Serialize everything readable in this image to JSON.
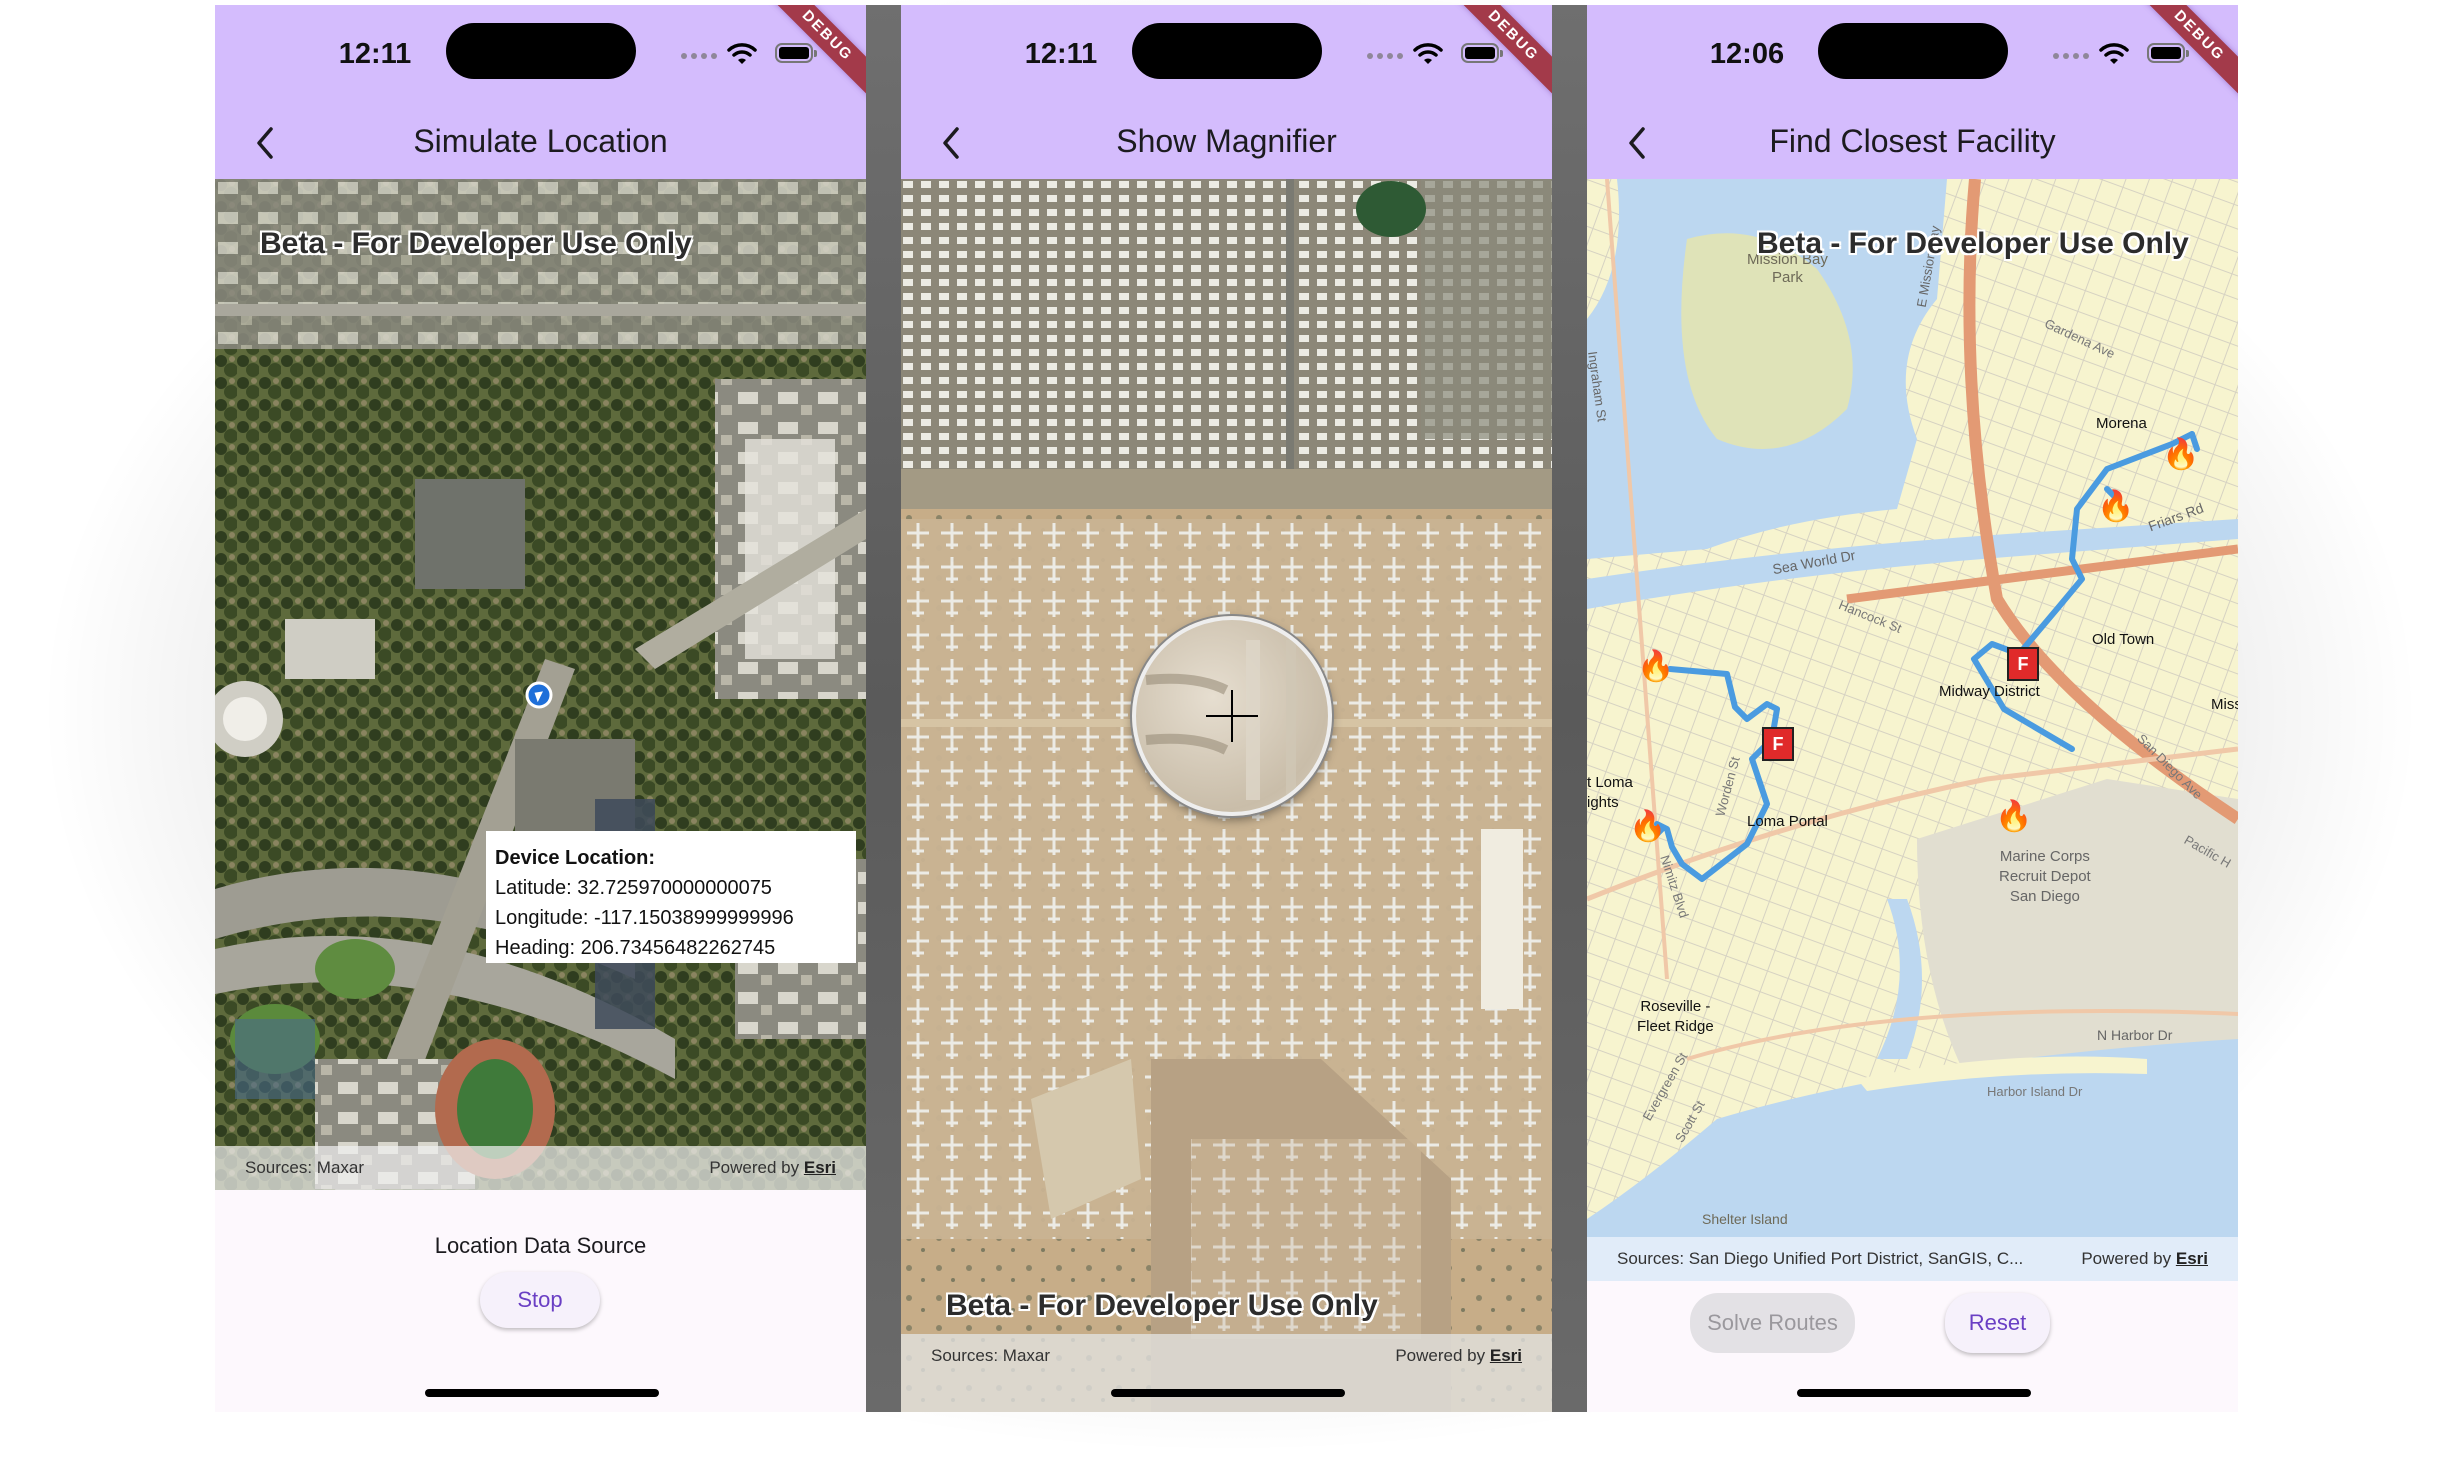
{
  "screens": [
    {
      "status_time": "12:11",
      "debug_banner": "DEBUG",
      "title": "Simulate Location",
      "watermark": "Beta - For Developer Use Only",
      "device_location": {
        "heading_label": "Device Location:",
        "latitude": "Latitude: 32.725970000000075",
        "longitude": "Longitude: -117.15038999999996",
        "heading": "Heading: 206.73456482262745"
      },
      "attribution": {
        "sources": "Sources: Maxar",
        "powered_by": "Powered by",
        "brand": "Esri"
      },
      "section_label": "Location Data Source",
      "stop_button": "Stop",
      "icons": [
        "back-chevron-icon",
        "wifi-icon",
        "battery-icon",
        "location-arrow-icon"
      ]
    },
    {
      "status_time": "12:11",
      "debug_banner": "DEBUG",
      "title": "Show Magnifier",
      "watermark": "Beta - For Developer Use Only",
      "attribution": {
        "sources": "Sources: Maxar",
        "powered_by": "Powered by",
        "brand": "Esri"
      },
      "icons": [
        "back-chevron-icon",
        "wifi-icon",
        "battery-icon",
        "magnifier-crosshair-icon"
      ]
    },
    {
      "status_time": "12:06",
      "debug_banner": "DEBUG",
      "title": "Find Closest Facility",
      "watermark": "Beta - For Developer Use Only",
      "map_labels": {
        "mission_bay_1": "Mission Bay",
        "mission_bay_2": "Park",
        "morena": "Morena",
        "sea_world": "Sea World Dr",
        "friars": "Friars Rd",
        "old_town": "Old Town",
        "midway": "Midway District",
        "hancock": "Hancock St",
        "loma_portal": "Loma Portal",
        "pt_loma_1": "t Loma",
        "pt_loma_2": "ights",
        "mcrd_1": "Marine Corps",
        "mcrd_2": "Recruit Depot",
        "mcrd_3": "San Diego",
        "roseville_1": "Roseville -",
        "roseville_2": "Fleet Ridge",
        "n_harbor": "N Harbor Dr",
        "harbor_island": "Harbor Island Dr",
        "shelter_island": "Shelter Island",
        "ingraham": "Ingraham St",
        "e_mission_bay": "E Mission Bay",
        "gardena": "Gardena Ave",
        "san_diego_ave": "San Diego Ave",
        "pacific_hwy": "Pacific H",
        "nimitz": "Nimitz Blvd",
        "worden": "Worden St",
        "evergreen": "Evergreen St",
        "scott": "Scott St",
        "miss": "Miss"
      },
      "attribution": {
        "sources": "Sources: San Diego Unified Port District, SanGIS, C...",
        "powered_by": "Powered by",
        "brand": "Esri"
      },
      "solve_button": "Solve Routes",
      "reset_button": "Reset",
      "icons": [
        "back-chevron-icon",
        "wifi-icon",
        "battery-icon",
        "fire-icon",
        "fire-station-icon"
      ]
    }
  ],
  "colors": {
    "appbar": "#d4bcfd",
    "accent": "#6a3fc4",
    "debug_banner": "#a33a4a",
    "route": "#4a9be0",
    "water": "#bcd7f0",
    "land": "#f7f4cf"
  }
}
